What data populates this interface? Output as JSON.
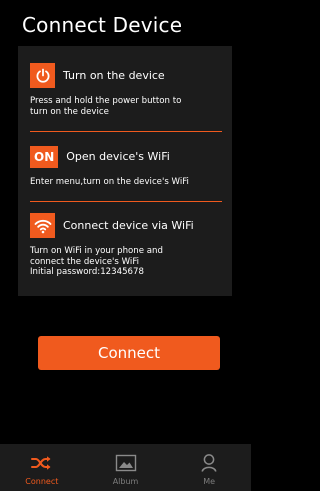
{
  "header": {
    "title": "Connect Device"
  },
  "steps": [
    {
      "icon": "power-icon",
      "badge": "",
      "title": "Turn on the device",
      "description": "Press and hold the power button to\nturn on the device"
    },
    {
      "icon": "on-badge",
      "badge": "ON",
      "title": "Open device's WiFi",
      "description": "Enter menu,turn on the device's WiFi"
    },
    {
      "icon": "wifi-icon",
      "badge": "",
      "title": "Connect device via WiFi",
      "description": "Turn on WiFi in your phone and\nconnect the device's WiFi\nInitial password:12345678"
    }
  ],
  "connect_label": "Connect",
  "tabs": [
    {
      "label": "Connect",
      "icon": "shuffle-icon",
      "active": true
    },
    {
      "label": "Album",
      "icon": "image-icon",
      "active": false
    },
    {
      "label": "Me",
      "icon": "person-icon",
      "active": false
    }
  ],
  "colors": {
    "accent": "#f05a1e",
    "background": "#000000",
    "card": "#1c1c1c",
    "inactive": "#7d7d7d"
  }
}
